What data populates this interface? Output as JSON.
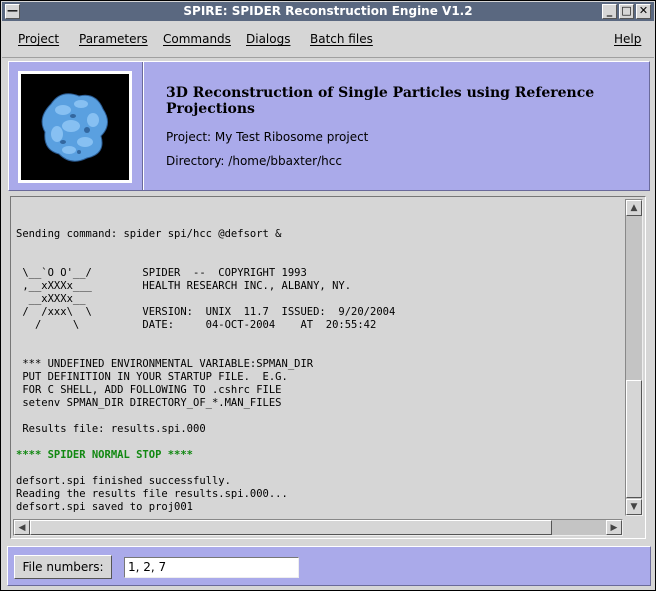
{
  "window": {
    "title": "SPIRE: SPIDER Reconstruction Engine V1.2"
  },
  "menu": {
    "project": "Project",
    "parameters": "Parameters",
    "commands": "Commands",
    "dialogs": "Dialogs",
    "batch_files": "Batch files",
    "help": "Help"
  },
  "header": {
    "headline": "3D Reconstruction of Single Particles using Reference Projections",
    "project_line": "Project: My Test Ribosome project",
    "directory_line": "Directory: /home/bbaxter/hcc"
  },
  "console": {
    "lines": [
      "Sending command: spider spi/hcc @defsort &",
      "",
      " \\__`O O'__/        SPIDER  --  COPYRIGHT 1993",
      " ,__xXXXx___        HEALTH RESEARCH INC., ALBANY, NY.",
      "  __xXXXx__",
      " /  /xxx\\  \\        VERSION:  UNIX  11.7  ISSUED:  9/20/2004",
      "   /     \\          DATE:     04-OCT-2004    AT  20:55:42",
      "",
      "",
      " *** UNDEFINED ENVIRONMENTAL VARIABLE:SPMAN_DIR",
      " PUT DEFINITION IN YOUR STARTUP FILE.  E.G.",
      " FOR C SHELL, ADD FOLLOWING TO .cshrc FILE",
      " setenv SPMAN_DIR DIRECTORY_OF_*.MAN_FILES",
      "",
      " Results file: results.spi.000",
      "",
      "**** SPIDER NORMAL STOP ****",
      "",
      "defsort.spi finished successfully.",
      "Reading the results file results.spi.000...",
      "defsort.spi saved to proj001"
    ]
  },
  "bottom": {
    "file_numbers_label": "File numbers:",
    "file_numbers_value": "1, 2, 7"
  },
  "colors": {
    "header_bg": "#aaaaea",
    "titlebar_bg": "#5a6880",
    "stop_text": "#118811"
  },
  "icons": {
    "window_menu": "window-menu-icon",
    "minimize": "minimize-icon",
    "maximize": "maximize-icon",
    "close": "close-icon"
  }
}
